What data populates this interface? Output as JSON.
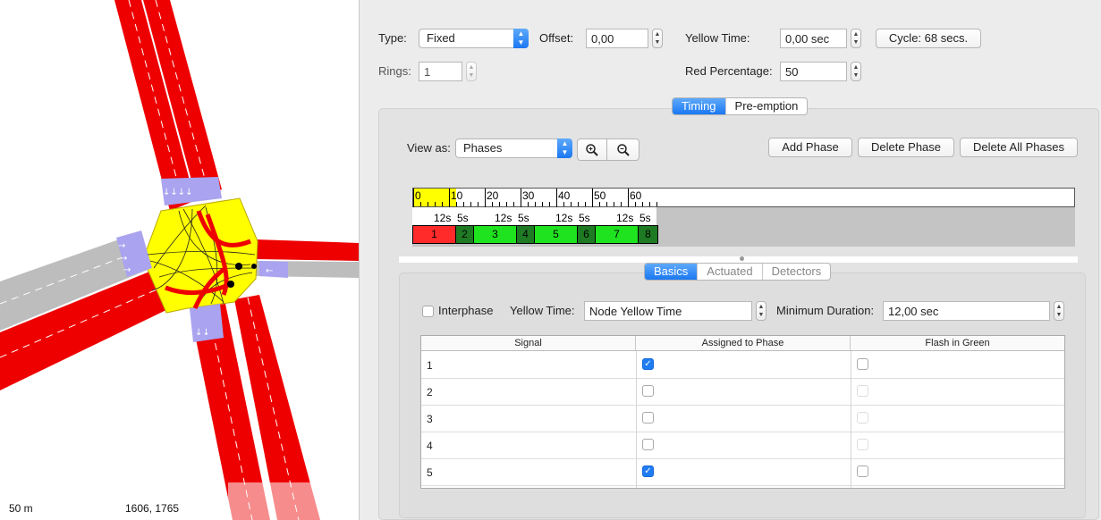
{
  "map": {
    "scale_label": "50 m",
    "coordinates": "1606, 1765"
  },
  "signal_program": {
    "type_label": "Type:",
    "type_value": "Fixed",
    "offset_label": "Offset:",
    "offset_value": "0,00",
    "yellow_time_label": "Yellow Time:",
    "yellow_time_value": "0,00 sec",
    "cycle_button": "Cycle: 68 secs.",
    "rings_label": "Rings:",
    "rings_value": "1",
    "red_percentage_label": "Red Percentage:",
    "red_percentage_value": "50"
  },
  "main_tabs": [
    {
      "label": "Timing",
      "active": true
    },
    {
      "label": "Pre-emption",
      "active": false
    }
  ],
  "timing": {
    "view_as_label": "View as:",
    "view_as_value": "Phases",
    "zoom_in_icon": "zoom-in-icon",
    "zoom_out_icon": "zoom-out-icon",
    "add_phase": "Add Phase",
    "delete_phase": "Delete Phase",
    "delete_all_phases": "Delete All Phases"
  },
  "timeline": {
    "ticks": [
      "0",
      "10",
      "20",
      "30",
      "40",
      "50",
      "60"
    ],
    "cycle_seconds": 68,
    "highlight_range": [
      0,
      12
    ],
    "durations": [
      "12s",
      "5s",
      "12s",
      "5s",
      "12s",
      "5s",
      "12s",
      "5s"
    ],
    "phases": [
      {
        "label": "1",
        "seconds": 12,
        "color": "#ff2a2a"
      },
      {
        "label": "2",
        "seconds": 5,
        "color": "#1f7a24"
      },
      {
        "label": "3",
        "seconds": 12,
        "color": "#1fe31f"
      },
      {
        "label": "4",
        "seconds": 5,
        "color": "#1f7a24"
      },
      {
        "label": "5",
        "seconds": 12,
        "color": "#1fe31f"
      },
      {
        "label": "6",
        "seconds": 5,
        "color": "#1f7a24"
      },
      {
        "label": "7",
        "seconds": 12,
        "color": "#1fe31f"
      },
      {
        "label": "8",
        "seconds": 5,
        "color": "#1f7a24"
      }
    ]
  },
  "phase_tabs": [
    {
      "label": "Basics",
      "active": true
    },
    {
      "label": "Actuated",
      "active": false
    },
    {
      "label": "Detectors",
      "active": false
    }
  ],
  "basics": {
    "interphase_label": "Interphase",
    "interphase_checked": false,
    "yellow_time_label": "Yellow Time:",
    "yellow_time_value": "Node Yellow Time",
    "min_duration_label": "Minimum Duration:",
    "min_duration_value": "12,00 sec"
  },
  "signal_table": {
    "headers": [
      "Signal",
      "Assigned to Phase",
      "Flash in Green"
    ],
    "rows": [
      {
        "signal": "1",
        "assigned": true,
        "flash": false,
        "flash_enabled": true
      },
      {
        "signal": "2",
        "assigned": false,
        "flash": false,
        "flash_enabled": false
      },
      {
        "signal": "3",
        "assigned": false,
        "flash": false,
        "flash_enabled": false
      },
      {
        "signal": "4",
        "assigned": false,
        "flash": false,
        "flash_enabled": false
      },
      {
        "signal": "5",
        "assigned": true,
        "flash": false,
        "flash_enabled": true
      }
    ]
  },
  "colors": {
    "accent": "#1f7cf2",
    "road_red": "#ee0000",
    "junction_yellow": "#ffff00",
    "crossing_lilac": "#a9a3f0"
  }
}
